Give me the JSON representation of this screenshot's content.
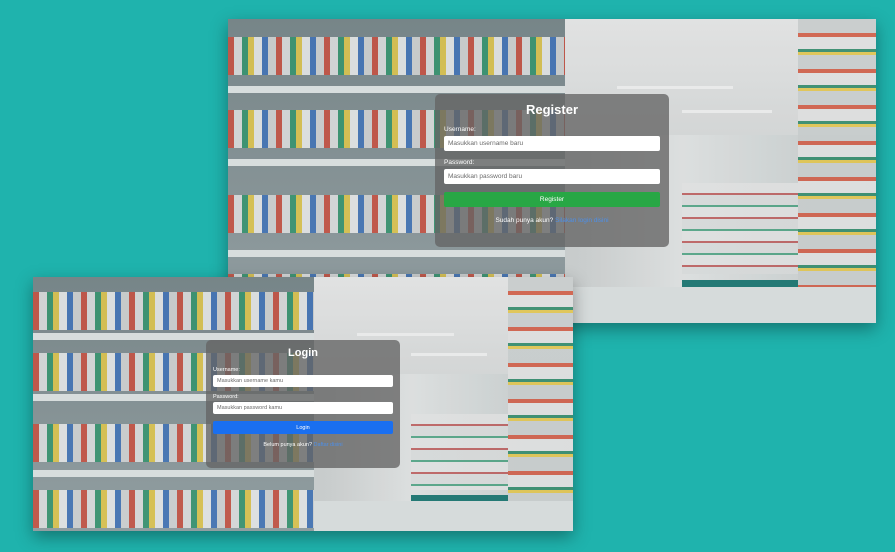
{
  "register": {
    "title": "Register",
    "username_label": "Username:",
    "username_placeholder": "Masukkan username baru",
    "password_label": "Password:",
    "password_placeholder": "Masukkan password baru",
    "button_label": "Register",
    "switch_prompt": "Sudah punya akun?",
    "switch_link": "Silakan login disini"
  },
  "login": {
    "title": "Login",
    "username_label": "Username:",
    "username_placeholder": "Masukkan username kamu",
    "password_label": "Password:",
    "password_placeholder": "Masukkan password kamu",
    "button_label": "Login",
    "switch_prompt": "Belum punya akun?",
    "switch_link": "Daftar disini"
  },
  "colors": {
    "page_background": "#1fb3ad",
    "register_button": "#28a745",
    "login_button": "#1a6ff0",
    "link": "#4d8fe8"
  }
}
